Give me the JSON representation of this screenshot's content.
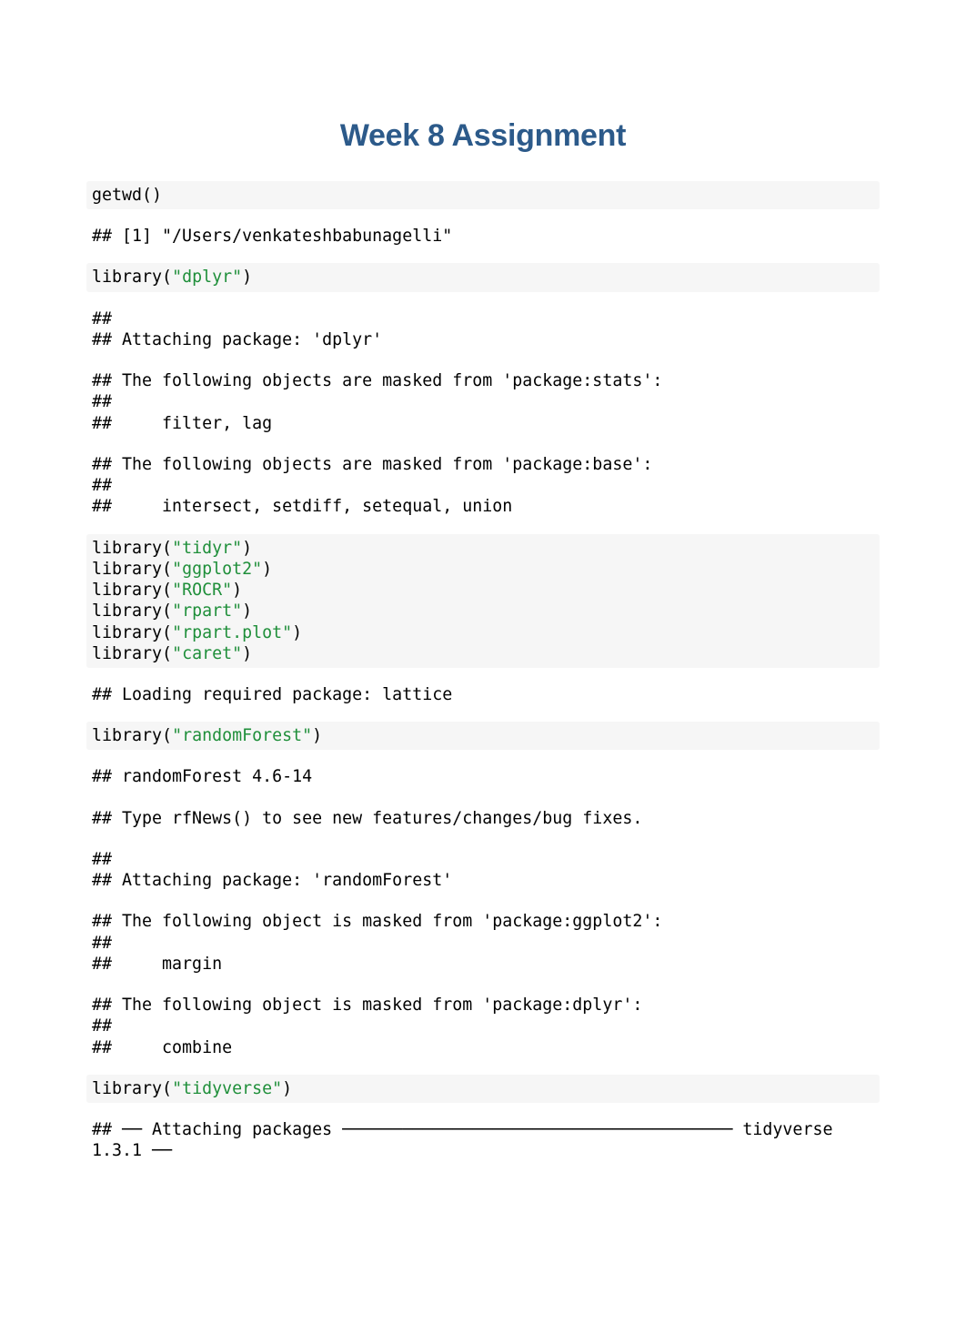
{
  "title": "Week 8 Assignment",
  "blocks": {
    "b1": {
      "type": "code",
      "plain": "getwd()"
    },
    "b2": {
      "type": "out",
      "plain": "## [1] \"/Users/venkateshbabunagelli\""
    },
    "b3": {
      "type": "code",
      "pre": "library(",
      "str": "\"dplyr\"",
      "post": ")"
    },
    "b4": {
      "type": "out",
      "plain": "## \n## Attaching package: 'dplyr'"
    },
    "b5": {
      "type": "out",
      "plain": "## The following objects are masked from 'package:stats':\n## \n##     filter, lag"
    },
    "b6": {
      "type": "out",
      "plain": "## The following objects are masked from 'package:base':\n## \n##     intersect, setdiff, setequal, union"
    },
    "b7": {
      "type": "code",
      "libs": [
        "\"tidyr\"",
        "\"ggplot2\"",
        "\"ROCR\"",
        "\"rpart\"",
        "\"rpart.plot\"",
        "\"caret\""
      ]
    },
    "b8": {
      "type": "out",
      "plain": "## Loading required package: lattice"
    },
    "b9": {
      "type": "code",
      "pre": "library(",
      "str": "\"randomForest\"",
      "post": ")"
    },
    "b10": {
      "type": "out",
      "plain": "## randomForest 4.6-14"
    },
    "b11": {
      "type": "out",
      "plain": "## Type rfNews() to see new features/changes/bug fixes."
    },
    "b12": {
      "type": "out",
      "plain": "## \n## Attaching package: 'randomForest'"
    },
    "b13": {
      "type": "out",
      "plain": "## The following object is masked from 'package:ggplot2':\n## \n##     margin"
    },
    "b14": {
      "type": "out",
      "plain": "## The following object is masked from 'package:dplyr':\n## \n##     combine"
    },
    "b15": {
      "type": "code",
      "pre": "library(",
      "str": "\"tidyverse\"",
      "post": ")"
    },
    "b16": {
      "type": "out",
      "plain": "## ── Attaching packages ─────────────────────────────────────── tidyverse 1.3.1 ──"
    }
  }
}
